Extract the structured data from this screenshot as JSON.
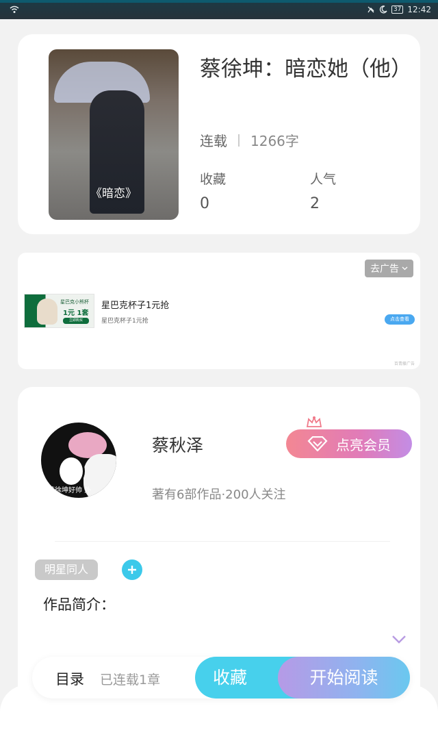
{
  "status_bar": {
    "battery": "37",
    "time": "12:42"
  },
  "book": {
    "cover_text": "《暗恋》",
    "title": "蔡徐坤：暗恋她（他）",
    "status": "连载",
    "word_count": "1266字",
    "stats": [
      {
        "label": "收藏",
        "value": "0"
      },
      {
        "label": "人气",
        "value": "2"
      }
    ]
  },
  "ad": {
    "close_label": "去广告",
    "image_caption": "星巴克小熊杯",
    "image_price": "1元 1套",
    "image_button": "立即购买",
    "title": "星巴克杯子1元抢",
    "subtitle": "星巴克杯子1元抢",
    "cta": "点击查看",
    "source": "百青藤广告"
  },
  "author": {
    "name": "蔡秋泽",
    "info": "著有6部作品·200人关注",
    "avatar_text": "蔡徐坤好帅 外",
    "vip_button": "点亮会员",
    "tag": "明星同人",
    "intro_label": "作品简介："
  },
  "action_bar": {
    "toc": "目录",
    "chapters": "已连载1章",
    "collect": "收藏",
    "read": "开始阅读"
  },
  "colors": {
    "accent_cyan": "#47d0ec",
    "vip_pink": "#f38793",
    "read_gradient_start": "#b69ae6"
  }
}
